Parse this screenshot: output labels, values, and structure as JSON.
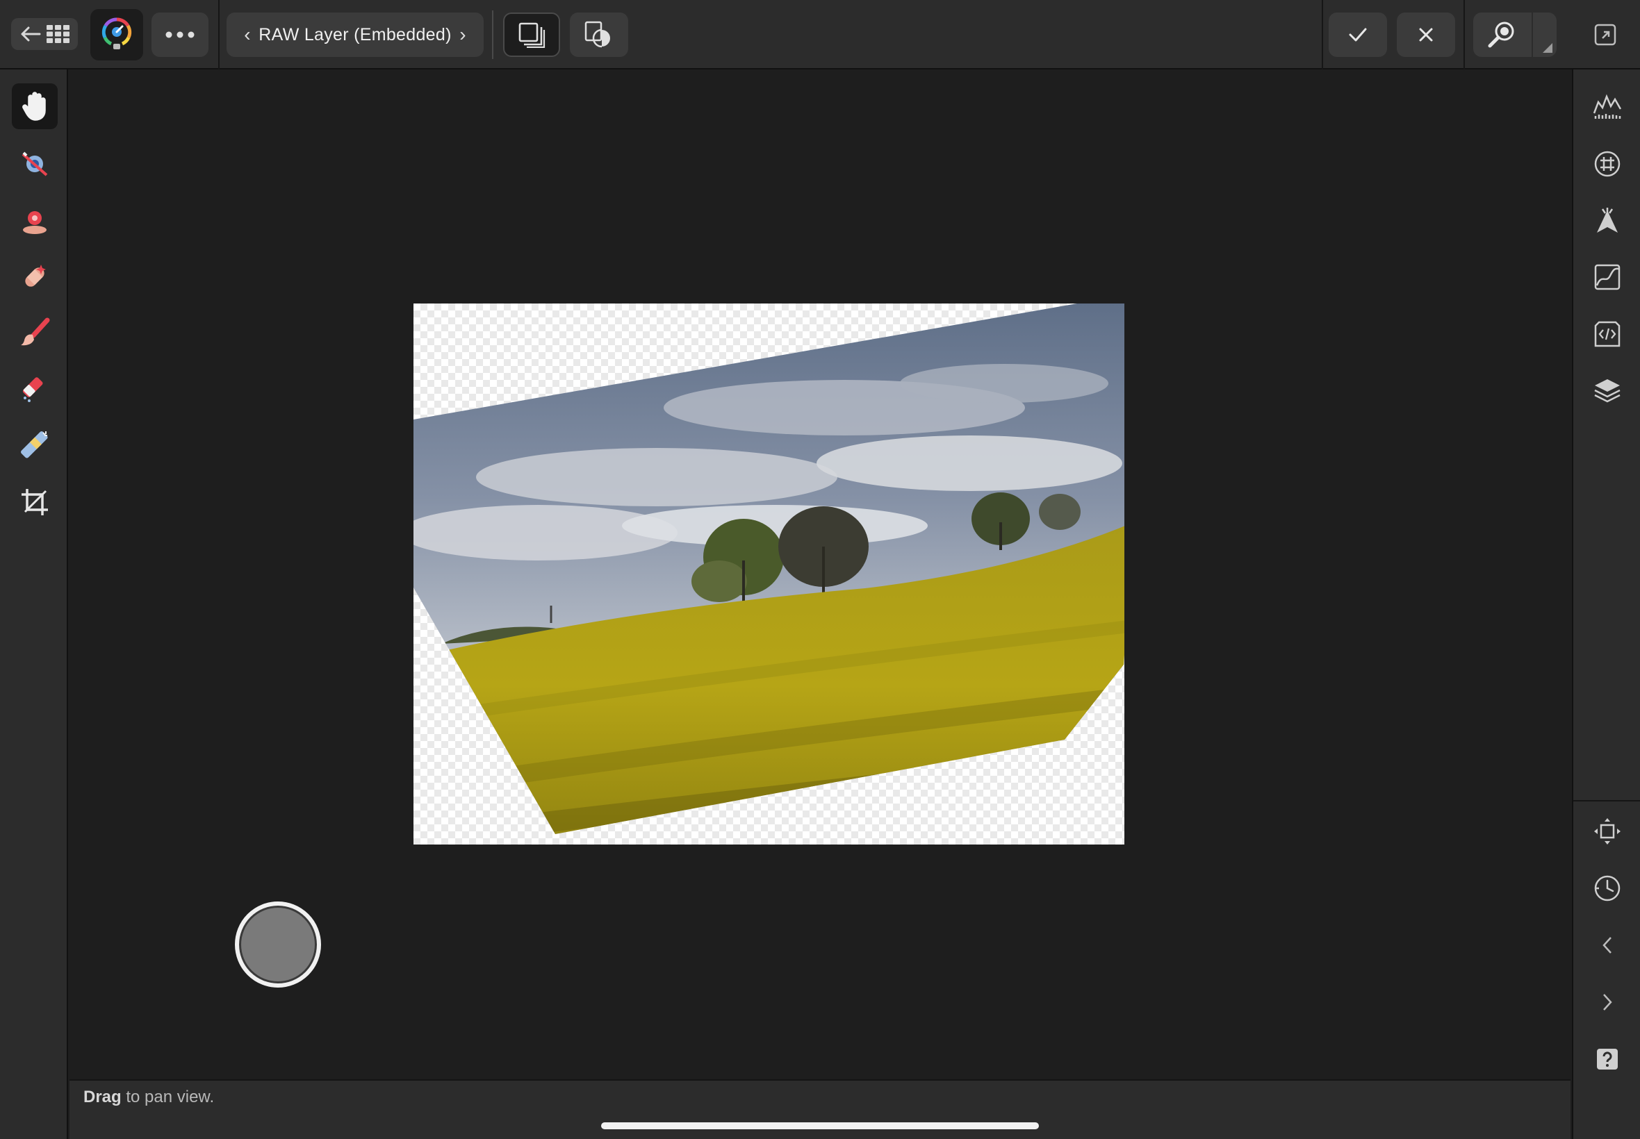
{
  "toolbar": {
    "layer_label": "RAW Layer (Embedded)",
    "prev_glyph": "‹",
    "next_glyph": "›",
    "icons": [
      "back-arrow-icon",
      "grid-icon",
      "persona-icon",
      "more-icon",
      "layers-icon",
      "view-mode-icon",
      "commit-icon",
      "cancel-icon",
      "zoom-icon",
      "fullscreen-icon"
    ]
  },
  "left_tools": [
    {
      "name": "view-tool-icon",
      "active": true
    },
    {
      "name": "red-eye-tool-icon",
      "active": false
    },
    {
      "name": "blemish-tool-icon",
      "active": false
    },
    {
      "name": "inpainting-tool-icon",
      "active": false
    },
    {
      "name": "paint-brush-tool-icon",
      "active": false
    },
    {
      "name": "erase-brush-tool-icon",
      "active": false
    },
    {
      "name": "clone-tool-icon",
      "active": false
    },
    {
      "name": "crop-tool-icon",
      "active": false
    }
  ],
  "right_studios": [
    "histogram-icon",
    "lens-icon",
    "focus-icon",
    "tones-icon",
    "scope-icon",
    "layers-stack-icon",
    "transform-icon",
    "history-icon",
    "chevron-left-icon",
    "chevron-right-icon",
    "help-icon"
  ],
  "status": {
    "bold": "Drag",
    "rest": " to pan view."
  },
  "colors": {
    "toolbar_bg": "#2c2c2c",
    "canvas_bg": "#1e1e1e",
    "accent_red": "#e8434f",
    "field_yellow": "#b7a410"
  }
}
